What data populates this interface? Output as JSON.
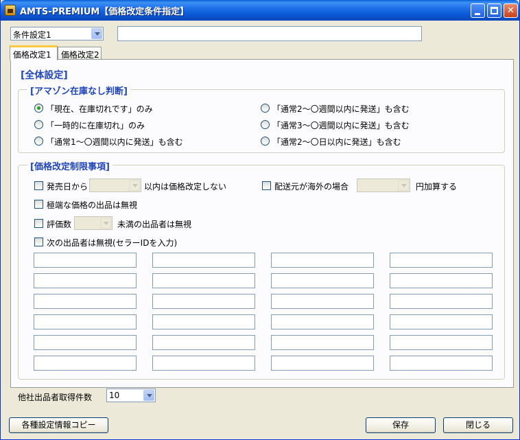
{
  "window": {
    "title": "AMTS-PREMIUM【価格改定条件指定】"
  },
  "top": {
    "profile_select": "条件設定1",
    "profile_name_value": ""
  },
  "tabs": [
    {
      "label": "価格改定1",
      "active": true
    },
    {
      "label": "価格改定2",
      "active": false
    }
  ],
  "panel": {
    "section_title": "[全体設定]",
    "amazon_group": {
      "title": "[アマゾン在庫なし判断]",
      "options": [
        {
          "label": "「現在、在庫切れです」のみ",
          "checked": true
        },
        {
          "label": "「一時的に在庫切れ」のみ",
          "checked": false
        },
        {
          "label": "「通常1～〇週間以内に発送」も含む",
          "checked": false
        },
        {
          "label": "「通常2～〇週間以内に発送」も含む",
          "checked": false
        },
        {
          "label": "「通常3～〇週間以内に発送」も含む",
          "checked": false
        },
        {
          "label": "「通常2～〇日以内に発送」も含む",
          "checked": false
        }
      ]
    },
    "limit_group": {
      "title": "[価格改定制限事項]",
      "release_date_label": "発売日から",
      "release_date_suffix": "以内は価格改定しない",
      "overseas_label": "配送元が海外の場合",
      "overseas_suffix": "円加算する",
      "ignore_extreme_label": "極端な価格の出品は無視",
      "rating_label": "評価数",
      "rating_suffix": "未満の出品者は無視",
      "ignore_sellers_label": "次の出品者は無視(セラーIDを入力)",
      "seller_id_rows": 6,
      "seller_id_cols": 4
    },
    "fetch_count_label": "他社出品者取得件数",
    "fetch_count_value": "10"
  },
  "footer": {
    "copy_button": "各種設定情報コピー",
    "save_button": "保存",
    "close_button": "閉じる"
  },
  "colors": {
    "titlebar": "#0b58d6",
    "section_title": "#2146b8",
    "radio_checked": "#21a121",
    "active_tab_accent": "#ffc73c"
  }
}
